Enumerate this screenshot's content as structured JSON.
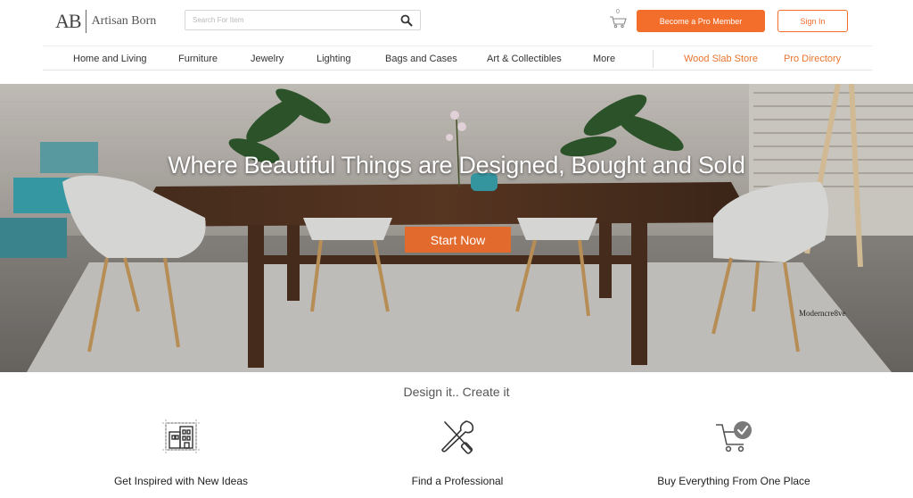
{
  "header": {
    "logo_mark": "AB",
    "logo_text": "Artisan Born",
    "search_placeholder": "Search For Item",
    "cart_count": "0",
    "pro_button": "Become a Pro Member",
    "signin_button": "Sign In"
  },
  "nav": {
    "items": [
      "Home and Living",
      "Furniture",
      "Jewelry",
      "Lighting",
      "Bags and Cases",
      "Art & Collectibles",
      "More"
    ],
    "right_items": [
      "Wood Slab Store",
      "Pro Directory"
    ]
  },
  "hero": {
    "title": "Where Beautiful Things are Designed, Bought and Sold",
    "cta": "Start Now",
    "watermark": "Moderncre8ve"
  },
  "features": {
    "tagline": "Design it.. Create it",
    "items": [
      {
        "label": "Get Inspired with New Ideas",
        "icon": "blueprint-building-icon"
      },
      {
        "label": "Find a Professional",
        "icon": "tools-icon"
      },
      {
        "label": "Buy Everything From One Place",
        "icon": "cart-check-icon"
      }
    ]
  },
  "colors": {
    "accent": "#f36d2b",
    "cta": "#e26a2c",
    "nav_accent": "#e8752f"
  }
}
